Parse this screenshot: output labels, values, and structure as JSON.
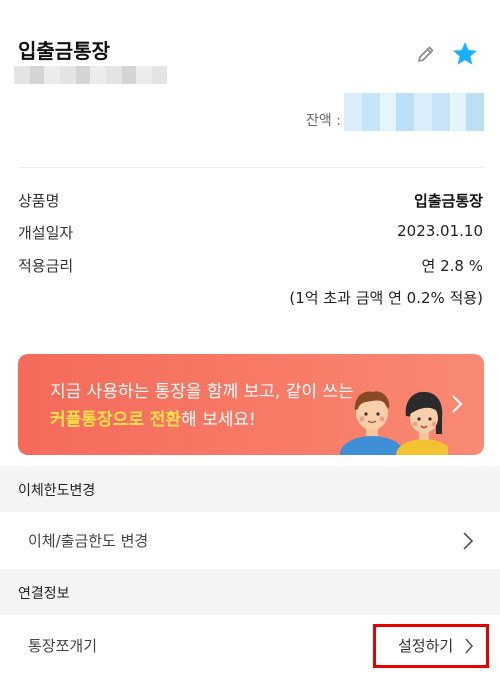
{
  "account": {
    "title": "입출금통장",
    "balance_label": "잔액 :"
  },
  "details": {
    "rows": [
      {
        "label": "상품명",
        "value": "입출금통장"
      },
      {
        "label": "개설일자",
        "value": "2023.01.10"
      },
      {
        "label": "적용금리",
        "value": "연 2.8 %"
      }
    ],
    "note": "(1억 초과 금액 연 0.2% 적용)"
  },
  "banner": {
    "line1": "지금 사용하는 통장을 함께 보고, 같이 쓰는",
    "highlight": "커플통장으로 전환",
    "line2_rest": "해 보세요!"
  },
  "sections": [
    {
      "header": "이체한도변경",
      "item": "이체/출금한도 변경"
    },
    {
      "header": "연결정보",
      "item": "통장쪼개기",
      "action": "설정하기"
    }
  ],
  "colors": {
    "banner": "#f56a5a",
    "highlight": "#ffe24a",
    "star": "#1ab0ff",
    "red_outline": "#e60000"
  },
  "icons": {
    "edit": "pencil-icon",
    "favorite": "star-icon",
    "chevron": "chevron-right-icon"
  }
}
